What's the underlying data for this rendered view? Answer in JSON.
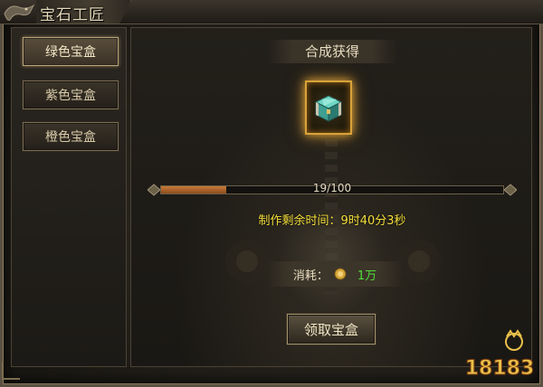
{
  "window": {
    "title": "宝石工匠"
  },
  "sidebar": {
    "items": [
      {
        "label": "绿色宝盒",
        "active": true
      },
      {
        "label": "紫色宝盒",
        "active": false
      },
      {
        "label": "橙色宝盒",
        "active": false
      }
    ]
  },
  "main": {
    "result_title": "合成获得",
    "item_icon": "jade-treasure-box-icon",
    "progress": {
      "text": "19/100",
      "current": 19,
      "total": 100
    },
    "time_remaining": "制作剩余时间：9时40分3秒",
    "cost": {
      "label": "消耗：",
      "icon": "gold-coin-icon",
      "value": "1万"
    },
    "claim_button_label": "领取宝盒"
  },
  "watermark": {
    "text": "18183",
    "icon": "18183-logo"
  },
  "colors": {
    "accent_gold": "#d9a23a",
    "progress_fill": "#c87a3a",
    "time_text": "#f5df3a",
    "cost_value": "#4fde3a",
    "watermark": "#e8c14a"
  }
}
